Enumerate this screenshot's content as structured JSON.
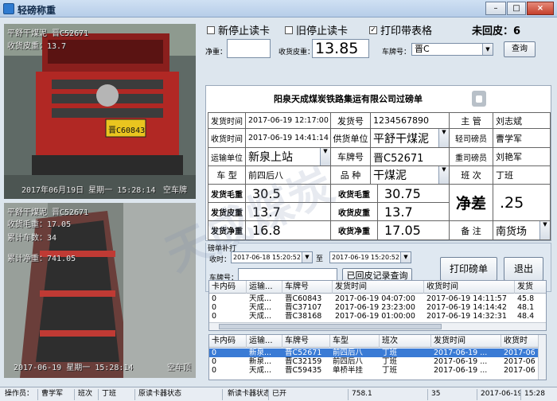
{
  "window": {
    "title": "轻磅称重",
    "min": "–",
    "max": "□",
    "close": "×"
  },
  "cameras": {
    "top": {
      "line1": "平舒干煤泥  晋C52671",
      "line2": "收货皮重：13.7",
      "timestamp": "2017年06月19日  星期一  15:28:14",
      "channel": "空车牌",
      "plate": "晋C60843"
    },
    "bottom": {
      "line1": "平舒干煤泥  晋C52671",
      "line2": "收货毛重：17.05",
      "line3": "累计车数：34",
      "line4": "累计净重：741.05",
      "timestamp": "2017-06-19  星期一  15:28:14",
      "channel": "空车顶"
    }
  },
  "options": {
    "new_stop": {
      "label": "新停止读卡",
      "checked": false
    },
    "old_stop": {
      "label": "旧停止读卡",
      "checked": false
    },
    "print_table": {
      "label": "打印带表格",
      "checked": true
    },
    "unreturned_label": "未回皮：",
    "unreturned_value": "6"
  },
  "toolbar": {
    "net_label": "净重：",
    "net_value": "",
    "tare_label": "收货皮重：",
    "tare_value": "13.85",
    "plate_label": "车牌号：",
    "plate_value": "晋C",
    "query_button": "查询"
  },
  "form": {
    "company": "阳泉天成煤炭铁路集运有限公司过磅单",
    "send_time_label": "发货时间",
    "send_time": "2017-06-19 12:17:00",
    "ship_no_label": "发货号",
    "ship_no": "1234567890",
    "manager_label": "主  管",
    "manager": "刘志斌",
    "recv_time_label": "收货时间",
    "recv_time": "2017-06-19 14:41:14",
    "supplier_label": "供货单位",
    "supplier": "平舒干煤泥",
    "light_weigher_label": "轻司磅员",
    "light_weigher": "曹学军",
    "carrier_label": "运输单位",
    "carrier": "新泉上站",
    "plate_label": "车牌号",
    "plate": "晋C52671",
    "heavy_weigher_label": "重司磅员",
    "heavy_weigher": "刘艳军",
    "vehicle_label": "车  型",
    "vehicle": "前四后八",
    "product_label": "品  种",
    "product": "干煤泥",
    "shift_label": "班  次",
    "shift": "丁班",
    "send_gross_label": "发货毛重",
    "send_gross": "30.5",
    "recv_gross_label": "收货毛重",
    "recv_gross": "30.75",
    "net_diff_label": "净差",
    "net_diff": ".25",
    "send_tare_label": "发货皮重",
    "send_tare": "13.7",
    "recv_tare_label": "收货皮重",
    "recv_tare": "13.7",
    "send_net_label": "发货净重",
    "send_net": "16.8",
    "recv_net_label": "收货净重",
    "recv_net": "17.05",
    "remark_label": "备  注",
    "remark": "南货场"
  },
  "reprint": {
    "group_label": "磅单补打",
    "from_label": "收时：",
    "from": "2017-06-18 15:20:52",
    "to_label": "至",
    "to": "2017-06-19 15:20:52",
    "plate_label": "车牌号：",
    "plate": "",
    "query_button": "已回皮记录查询",
    "print_button": "打印磅单",
    "exit_button": "退出"
  },
  "grid_top": {
    "columns": [
      "卡内码",
      "运输...",
      "车牌号",
      "发货时间",
      "收货时间",
      "发货"
    ],
    "rows": [
      [
        "0",
        "天成...",
        "晋C60843",
        "2017-06-19 04:07:00",
        "2017-06-19 14:11:57",
        "45.8"
      ],
      [
        "0",
        "天成...",
        "晋C37107",
        "2017-06-19 23:23:00",
        "2017-06-19 14:14:42",
        "48.1"
      ],
      [
        "0",
        "天成...",
        "晋C38168",
        "2017-06-19 01:00:00",
        "2017-06-19 14:32:31",
        "48.4"
      ]
    ]
  },
  "grid_bottom": {
    "columns": [
      "卡内码",
      "运输...",
      "车牌号",
      "车型",
      "班次",
      "发货时间",
      "收货时"
    ],
    "rows": [
      [
        "0",
        "新泉...",
        "晋C52671",
        "前四后八",
        "丁班",
        "2017-06-19 ...",
        "2017-06"
      ],
      [
        "0",
        "新泉...",
        "晋C32159",
        "前四后八",
        "丁班",
        "2017-06-19 ...",
        "2017-06"
      ],
      [
        "0",
        "天成...",
        "晋C59435",
        "单桥半挂",
        "丁班",
        "2017-06-19 ...",
        "2017-06"
      ]
    ]
  },
  "statusbar": {
    "operator_label": "操作员：",
    "operator": "曹学军",
    "shift_label": "班次",
    "shift": "丁班",
    "old_reader_label": "原读卡器状态",
    "new_reader_label": "新读卡器状态",
    "new_reader": "已开",
    "weight": "758.1",
    "count": "35",
    "date": "2017-06-19",
    "time": "15:28"
  },
  "watermark": "天成煤炭",
  "colors": {
    "accent": "#3a7bd5",
    "titlebar": "#b6cde8"
  }
}
